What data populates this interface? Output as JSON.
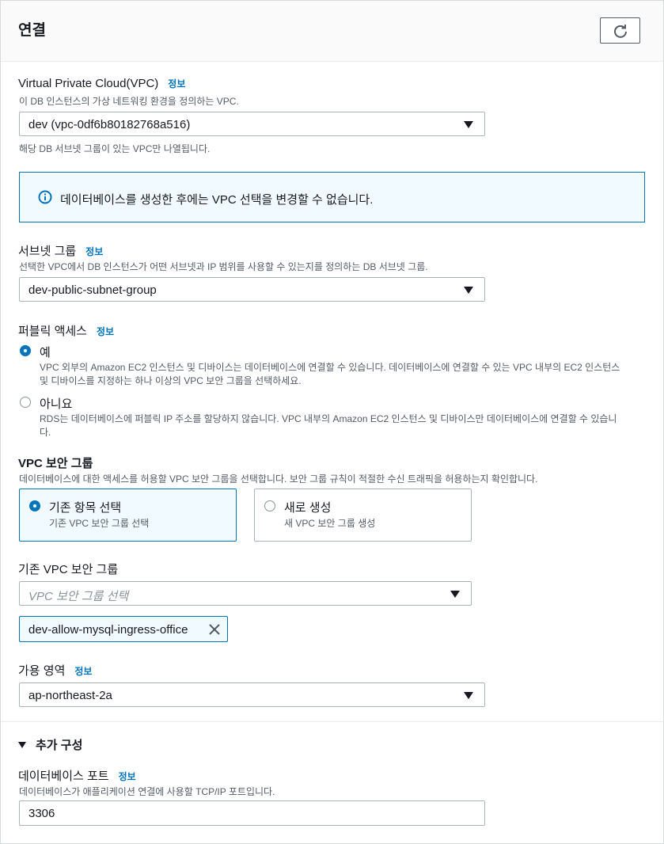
{
  "header": {
    "title": "연결",
    "refresh_icon": "refresh-icon"
  },
  "vpc": {
    "label": "Virtual Private Cloud(VPC)",
    "info": "정보",
    "description": "이 DB 인스턴스의 가상 네트워킹 환경을 정의하는 VPC.",
    "selected": "dev (vpc-0df6b80182768a516)",
    "hint": "해당 DB 서브넷 그룹이 있는 VPC만 나열됩니다."
  },
  "alert": {
    "icon": "info-circle-icon",
    "text": "데이터베이스를 생성한 후에는 VPC 선택을 변경할 수 없습니다."
  },
  "subnet_group": {
    "label": "서브넷 그룹",
    "info": "정보",
    "description": "선택한 VPC에서 DB 인스턴스가 어떤 서브넷과 IP 범위를 사용할 수 있는지를 정의하는 DB 서브넷 그룹.",
    "selected": "dev-public-subnet-group"
  },
  "public_access": {
    "label": "퍼블릭 액세스",
    "info": "정보",
    "options": [
      {
        "label": "예",
        "description_line1": "VPC 외부의 Amazon EC2 인스턴스 및 디바이스는 데이터베이스에 연결할 수 있습니다. 데이터베이스에 연결할 수 있는 VPC 내부의 EC2 인스턴스",
        "description_line2": "및 디바이스를 지정하는 하나 이상의 VPC 보안 그룹을 선택하세요.",
        "selected": true
      },
      {
        "label": "아니요",
        "description_line1": "RDS는 데이터베이스에 퍼블릭 IP 주소를 할당하지 않습니다. VPC 내부의 Amazon EC2 인스턴스 및 디바이스만 데이터베이스에 연결할 수 있습니",
        "description_line2": "다.",
        "selected": false
      }
    ]
  },
  "vpc_security_group": {
    "label": "VPC 보안 그룹",
    "description": "데이터베이스에 대한 액세스를 허용할 VPC 보안 그룹을 선택합니다. 보안 그룹 규칙이 적절한 수신 트래픽을 허용하는지 확인합니다.",
    "tiles": [
      {
        "title": "기존 항목 선택",
        "subtitle": "기존 VPC 보안 그룹 선택",
        "selected": true
      },
      {
        "title": "새로 생성",
        "subtitle": "새 VPC 보안 그룹 생성",
        "selected": false
      }
    ]
  },
  "existing_sg": {
    "label": "기존 VPC 보안 그룹",
    "placeholder": "VPC 보안 그룹 선택",
    "tokens": [
      "dev-allow-mysql-ingress-office"
    ]
  },
  "availability_zone": {
    "label": "가용 영역",
    "info": "정보",
    "selected": "ap-northeast-2a"
  },
  "additional_config": {
    "label": "추가 구성",
    "expanded": true
  },
  "db_port": {
    "label": "데이터베이스 포트",
    "info": "정보",
    "description": "데이터베이스가 애플리케이션 연결에 사용할 TCP/IP 포트입니다.",
    "value": "3306"
  },
  "colors": {
    "accent": "#0073bb",
    "alert_bg": "#f1faff",
    "text": "#16191f",
    "muted": "#545b64"
  }
}
